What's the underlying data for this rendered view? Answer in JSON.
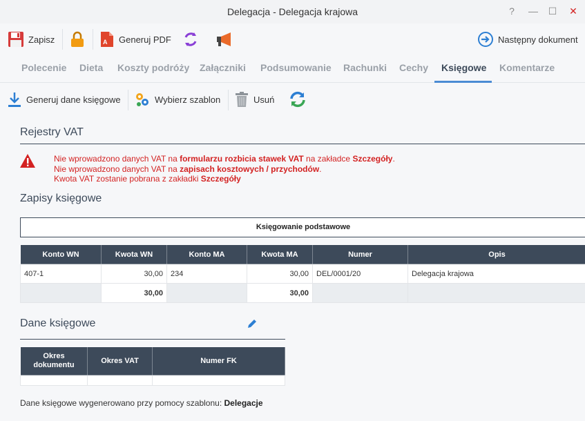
{
  "window": {
    "title": "Delegacja - Delegacja krajowa",
    "help": "?",
    "minimize": "—",
    "maximize": "☐",
    "close": "✕"
  },
  "toolbar": {
    "save": "Zapisz",
    "pdf": "Generuj PDF",
    "next": "Następny dokument"
  },
  "tabs": [
    "Polecenie",
    "Dieta",
    "Koszty podróży",
    "Załączniki",
    "Podsumowanie",
    "Rachunki",
    "Cechy",
    "Księgowe",
    "Komentarze"
  ],
  "active_tab": "Księgowe",
  "subtoolbar": {
    "generate": "Generuj dane księgowe",
    "template": "Wybierz szablon",
    "delete": "Usuń"
  },
  "vat": {
    "title": "Rejestry VAT",
    "line1_a": "Nie wprowadzono danych VAT na ",
    "line1_b": "formularzu rozbicia stawek VAT",
    "line1_c": " na zakładce ",
    "line1_d": "Szczegóły",
    "line1_e": ".",
    "line2_a": "Nie wprowadzono danych VAT na ",
    "line2_b": "zapisach kosztowych / przychodów",
    "line2_c": ".",
    "line3_a": "Kwota VAT zostanie pobrana z zakładki ",
    "line3_b": "Szczegóły"
  },
  "entries": {
    "title": "Zapisy księgowe",
    "box_label": "Księgowanie podstawowe",
    "columns": [
      "Konto WN",
      "Kwota WN",
      "Konto MA",
      "Kwota MA",
      "Numer",
      "Opis"
    ],
    "rows": [
      {
        "konto_wn": "407-1",
        "kwota_wn": "30,00",
        "konto_ma": "234",
        "kwota_ma": "30,00",
        "numer": "DEL/0001/20",
        "opis": "Delegacja krajowa"
      }
    ],
    "sum": {
      "kwota_wn": "30,00",
      "kwota_ma": "30,00"
    }
  },
  "accounting": {
    "title": "Dane księgowe",
    "columns": [
      "Okres dokumentu",
      "Okres VAT",
      "Numer FK"
    ],
    "footer_text": "Dane księgowe wygenerowano przy pomocy szablonu: ",
    "footer_value": "Delegacje"
  }
}
